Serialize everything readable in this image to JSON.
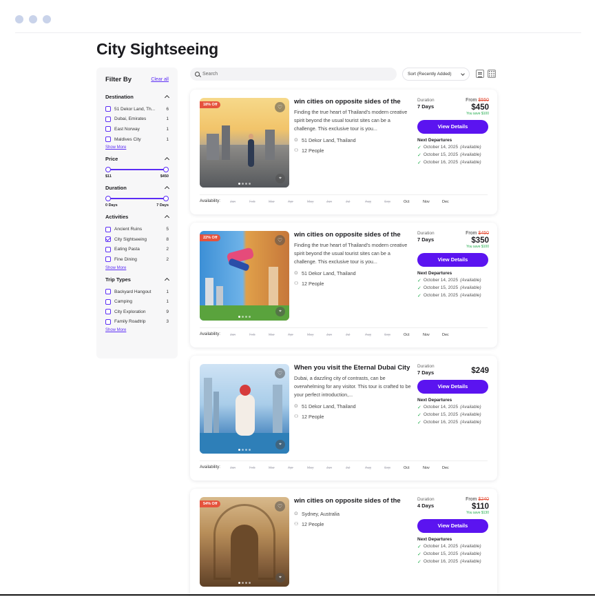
{
  "page": {
    "title": "City Sightseeing"
  },
  "sidebar": {
    "title": "Filter By",
    "clear_label": "Clear all",
    "destination": {
      "title": "Destination",
      "items": [
        {
          "label": "51 Dekor Land, Th...",
          "count": "6",
          "checked": false
        },
        {
          "label": "Dubai, Emirates",
          "count": "1",
          "checked": false
        },
        {
          "label": "East Norway",
          "count": "1",
          "checked": false
        },
        {
          "label": "Maldives City",
          "count": "1",
          "checked": false
        }
      ],
      "show_more": "Show More"
    },
    "price": {
      "title": "Price",
      "min": "$11",
      "max": "$450"
    },
    "duration": {
      "title": "Duration",
      "min": "0 Days",
      "max": "7 Days"
    },
    "activities": {
      "title": "Activities",
      "items": [
        {
          "label": "Ancient Ruins",
          "count": "5",
          "checked": false
        },
        {
          "label": "City Sightseeing",
          "count": "8",
          "checked": true
        },
        {
          "label": "Eating Pasta",
          "count": "2",
          "checked": false
        },
        {
          "label": "Fine Dining",
          "count": "2",
          "checked": false
        }
      ],
      "show_more": "Show More"
    },
    "trip_types": {
      "title": "Trip Types",
      "items": [
        {
          "label": "Backyard Hangout",
          "count": "1",
          "checked": false
        },
        {
          "label": "Camping",
          "count": "1",
          "checked": false
        },
        {
          "label": "City Exploration",
          "count": "9",
          "checked": false
        },
        {
          "label": "Family Roadtrip",
          "count": "3",
          "checked": false
        }
      ],
      "show_more": "Show More"
    }
  },
  "toolbar": {
    "search_placeholder": "Search",
    "sort_label": "Sort (Recently Added)"
  },
  "months": [
    "Jan",
    "Feb",
    "Mar",
    "Apr",
    "May",
    "Jun",
    "Jul",
    "Aug",
    "Sep",
    "Oct",
    "Nov",
    "Dec"
  ],
  "availability_label": "Availability:",
  "cards": [
    {
      "badge": "18% Off",
      "title": "win cities on opposite sides of the",
      "desc": "Finding the true heart of Thailand's modern creative spirit beyond the usual tourist sites can be a challenge. This exclusive tour is you...",
      "location": "51 Dekor Land, Thailand",
      "people": "12 People",
      "duration_label": "Duration",
      "duration": "7 Days",
      "from_label": "From",
      "old_price": "$550",
      "price": "$450",
      "save": "You save $100",
      "button": "View Details",
      "next_label": "Next Departures",
      "departures": [
        {
          "date": "October 14, 2025",
          "status": "(Available)"
        },
        {
          "date": "October 15, 2025",
          "status": "(Available)"
        },
        {
          "date": "October 16, 2025",
          "status": "(Available)"
        }
      ]
    },
    {
      "badge": "22% Off",
      "title": "win cities on opposite sides of the",
      "desc": "Finding the true heart of Thailand's modern creative spirit beyond the usual tourist sites can be a challenge. This exclusive tour is you...",
      "location": "51 Dekor Land, Thailand",
      "people": "12 People",
      "duration_label": "Duration",
      "duration": "7 Days",
      "from_label": "From",
      "old_price": "$450",
      "price": "$350",
      "save": "You save $100",
      "button": "View Details",
      "next_label": "Next Departures",
      "departures": [
        {
          "date": "October 14, 2025",
          "status": "(Available)"
        },
        {
          "date": "October 15, 2025",
          "status": "(Available)"
        },
        {
          "date": "October 16, 2025",
          "status": "(Available)"
        }
      ]
    },
    {
      "badge": "",
      "title": "When you visit the Eternal Dubai City",
      "desc": "Dubai, a dazzling city of contrasts, can be overwhelming for any visitor. This tour is crafted to be your perfect introduction,...",
      "location": "51 Dekor Land, Thailand",
      "people": "12 People",
      "duration_label": "Duration",
      "duration": "7 Days",
      "from_label": "",
      "old_price": "",
      "price": "$249",
      "save": "",
      "button": "View Details",
      "next_label": "Next Departures",
      "departures": [
        {
          "date": "October 14, 2025",
          "status": "(Available)"
        },
        {
          "date": "October 15, 2025",
          "status": "(Available)"
        },
        {
          "date": "October 16, 2025",
          "status": "(Available)"
        }
      ]
    },
    {
      "badge": "54% Off",
      "title": "win cities on opposite sides of the",
      "desc": "",
      "location": "Sydney, Australia",
      "people": "12 People",
      "duration_label": "Duration",
      "duration": "4 Days",
      "from_label": "From",
      "old_price": "$240",
      "price": "$110",
      "save": "You save $130",
      "button": "View Details",
      "next_label": "Next Departures",
      "departures": [
        {
          "date": "October 14, 2025",
          "status": "(Available)"
        },
        {
          "date": "October 15, 2025",
          "status": "(Available)"
        },
        {
          "date": "October 16, 2025",
          "status": "(Available)"
        }
      ]
    }
  ]
}
